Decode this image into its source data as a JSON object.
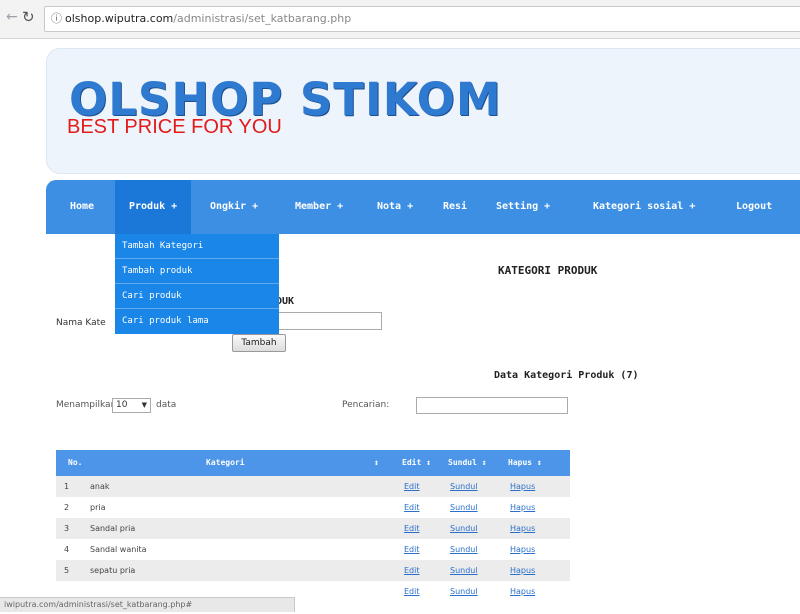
{
  "browser": {
    "url_host": "olshop.wiputra.com",
    "url_path": "/administrasi/set_katbarang.php"
  },
  "header": {
    "title": "OLSHOP STIKOM",
    "subtitle": "BEST PRICE FOR YOU"
  },
  "nav": {
    "items": [
      {
        "label": "Home"
      },
      {
        "label": "Produk +"
      },
      {
        "label": "Ongkir +"
      },
      {
        "label": "Member +"
      },
      {
        "label": "Nota +"
      },
      {
        "label": "Resi"
      },
      {
        "label": "Setting +"
      },
      {
        "label": "Kategori sosial +"
      },
      {
        "label": "Logout"
      }
    ],
    "active_index": 1
  },
  "dropdown": {
    "items": [
      {
        "label": "Tambah Kategori"
      },
      {
        "label": "Tambah produk"
      },
      {
        "label": "Cari produk"
      },
      {
        "label": "Cari produk lama"
      }
    ]
  },
  "content": {
    "page_title": "KATEGORI PRODUK",
    "form_title_visible": "DUK",
    "name_label": "Nama Kate",
    "add_button": "Tambah",
    "data_title": "Data Kategori Produk (7)",
    "show_label": "Menampilkan",
    "show_value": "10",
    "show_suffix": "data",
    "search_label": "Pencarian:"
  },
  "table": {
    "headers": [
      "No.",
      "Kategori",
      "↕",
      "Edit ↕",
      "Sundul ↕",
      "Hapus ↕"
    ],
    "rows": [
      {
        "no": "1",
        "kategori": "anak",
        "edit": "Edit",
        "sundul": "Sundul",
        "hapus": "Hapus"
      },
      {
        "no": "2",
        "kategori": "pria",
        "edit": "Edit",
        "sundul": "Sundul",
        "hapus": "Hapus"
      },
      {
        "no": "3",
        "kategori": "Sandal pria",
        "edit": "Edit",
        "sundul": "Sundul",
        "hapus": "Hapus"
      },
      {
        "no": "4",
        "kategori": "Sandal wanita",
        "edit": "Edit",
        "sundul": "Sundul",
        "hapus": "Hapus"
      },
      {
        "no": "5",
        "kategori": "sepatu pria",
        "edit": "Edit",
        "sundul": "Sundul",
        "hapus": "Hapus"
      },
      {
        "no": "",
        "kategori": "",
        "edit": "Edit",
        "sundul": "Sundul",
        "hapus": "Hapus"
      }
    ]
  },
  "statusbar": {
    "text": "iwiputra.com/administrasi/set_katbarang.php#"
  }
}
